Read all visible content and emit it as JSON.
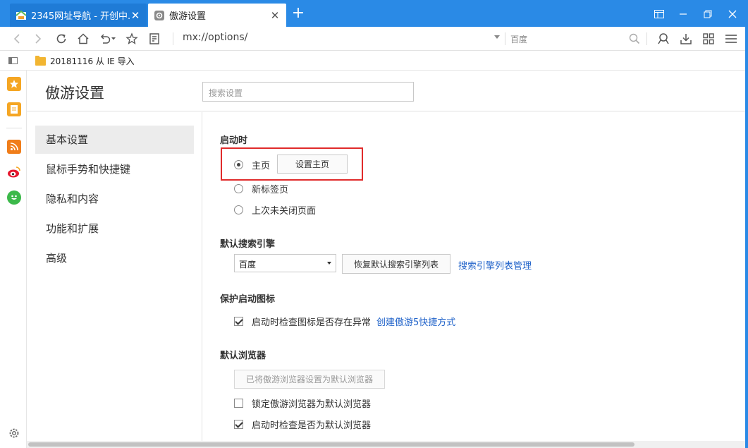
{
  "colors": {
    "titlebar": "#2a8ae6",
    "link": "#1f62c9",
    "highlight": "#e02b2b",
    "active_nav_bg": "#ececec"
  },
  "tabs": [
    {
      "title": "2345网址导航 - 开创中...",
      "icon": "2345-site-icon",
      "active": false
    },
    {
      "title": "傲游设置",
      "icon": "settings-gear-icon",
      "active": true
    }
  ],
  "newtab_label": "+",
  "close_glyph": "✕",
  "address": {
    "url": "mx://options/",
    "search_engine": "百度"
  },
  "bookmarks": [
    {
      "label": "20181116 从 IE 导入",
      "icon": "folder-icon"
    }
  ],
  "settings": {
    "title": "傲游设置",
    "search_placeholder": "搜索设置",
    "nav": [
      {
        "label": "基本设置",
        "active": true
      },
      {
        "label": "鼠标手势和快捷键",
        "active": false
      },
      {
        "label": "隐私和内容",
        "active": false
      },
      {
        "label": "功能和扩展",
        "active": false
      },
      {
        "label": "高级",
        "active": false
      }
    ],
    "startup": {
      "title": "启动时",
      "options": [
        {
          "label": "主页",
          "selected": true
        },
        {
          "label": "新标签页",
          "selected": false
        },
        {
          "label": "上次未关闭页面",
          "selected": false
        }
      ],
      "set_home_button": "设置主页"
    },
    "default_search": {
      "title": "默认搜索引擎",
      "selected": "百度",
      "restore_button": "恢复默认搜索引擎列表",
      "manage_link": "搜索引擎列表管理"
    },
    "protect_icon": {
      "title": "保护启动图标",
      "check_label": "启动时检查图标是否存在异常",
      "checked": true,
      "create_shortcut_link": "创建傲游5快捷方式"
    },
    "default_browser": {
      "title": "默认浏览器",
      "set_button": "已将傲游浏览器设置为默认浏览器",
      "lock_label": "锁定傲游浏览器为默认浏览器",
      "lock_checked": false,
      "check_label": "启动时检查是否为默认浏览器",
      "check_checked": true
    }
  }
}
